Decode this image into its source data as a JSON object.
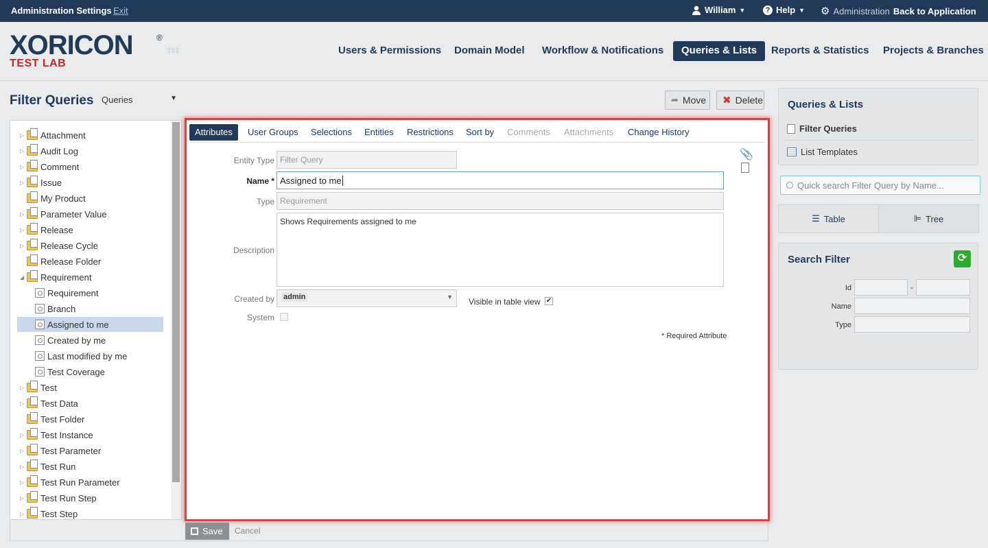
{
  "topbar": {
    "title": "Administration Settings",
    "exit": "Exit",
    "user": "William",
    "help": "Help",
    "admin": "Administration",
    "back": "Back to Application"
  },
  "logo": {
    "main": "XORICON",
    "sub": "TEST LAB"
  },
  "nav": [
    "Users & Permissions",
    "Domain Model",
    "Workflow & Notifications",
    "Queries & Lists",
    "Reports & Statistics",
    "Projects & Branches"
  ],
  "left": {
    "title": "Filter Queries",
    "select": "Queries",
    "tree": [
      {
        "label": "Attachment",
        "kind": "folder",
        "expand": "closed",
        "indent": 0
      },
      {
        "label": "Audit Log",
        "kind": "folder",
        "expand": "closed",
        "indent": 0
      },
      {
        "label": "Comment",
        "kind": "folder",
        "expand": "closed",
        "indent": 0
      },
      {
        "label": "Issue",
        "kind": "folder",
        "expand": "closed",
        "indent": 0
      },
      {
        "label": "My Product",
        "kind": "folder",
        "expand": "none",
        "indent": 0
      },
      {
        "label": "Parameter Value",
        "kind": "folder",
        "expand": "closed",
        "indent": 0
      },
      {
        "label": "Release",
        "kind": "folder",
        "expand": "closed",
        "indent": 0
      },
      {
        "label": "Release Cycle",
        "kind": "folder",
        "expand": "closed",
        "indent": 0
      },
      {
        "label": "Release Folder",
        "kind": "folder",
        "expand": "none",
        "indent": 0
      },
      {
        "label": "Requirement",
        "kind": "folder",
        "expand": "open",
        "indent": 0
      },
      {
        "label": "Requirement",
        "kind": "query",
        "expand": "none",
        "indent": 1
      },
      {
        "label": "Branch",
        "kind": "query",
        "expand": "none",
        "indent": 1
      },
      {
        "label": "Assigned to me",
        "kind": "query",
        "expand": "none",
        "indent": 1,
        "selected": true
      },
      {
        "label": "Created by me",
        "kind": "query",
        "expand": "none",
        "indent": 1
      },
      {
        "label": "Last modified by me",
        "kind": "query",
        "expand": "none",
        "indent": 1
      },
      {
        "label": "Test Coverage",
        "kind": "query",
        "expand": "none",
        "indent": 1
      },
      {
        "label": "Test",
        "kind": "folder",
        "expand": "closed",
        "indent": 0
      },
      {
        "label": "Test Data",
        "kind": "folder",
        "expand": "closed",
        "indent": 0
      },
      {
        "label": "Test Folder",
        "kind": "folder",
        "expand": "none",
        "indent": 0
      },
      {
        "label": "Test Instance",
        "kind": "folder",
        "expand": "closed",
        "indent": 0
      },
      {
        "label": "Test Parameter",
        "kind": "folder",
        "expand": "closed",
        "indent": 0
      },
      {
        "label": "Test Run",
        "kind": "folder",
        "expand": "closed",
        "indent": 0
      },
      {
        "label": "Test Run Parameter",
        "kind": "folder",
        "expand": "closed",
        "indent": 0
      },
      {
        "label": "Test Run Step",
        "kind": "folder",
        "expand": "closed",
        "indent": 0
      },
      {
        "label": "Test Step",
        "kind": "folder",
        "expand": "closed",
        "indent": 0
      }
    ]
  },
  "actions": {
    "move": "Move",
    "delete": "Delete"
  },
  "tabs": [
    {
      "label": "Attributes",
      "state": "active"
    },
    {
      "label": "User Groups",
      "state": "normal"
    },
    {
      "label": "Selections",
      "state": "normal"
    },
    {
      "label": "Entities",
      "state": "normal"
    },
    {
      "label": "Restrictions",
      "state": "normal"
    },
    {
      "label": "Sort by",
      "state": "normal"
    },
    {
      "label": "Comments",
      "state": "disabled"
    },
    {
      "label": "Attachments",
      "state": "disabled"
    },
    {
      "label": "Change History",
      "state": "normal"
    }
  ],
  "form": {
    "entity_type_label": "Entity Type",
    "entity_type": "Filter Query",
    "name_label": "Name *",
    "name": "Assigned to me",
    "type_label": "Type",
    "type": "Requirement",
    "description_label": "Description",
    "description": "Shows Requirements assigned to me",
    "created_by_label": "Created by",
    "created_by": "admin",
    "visible_label": "Visible in table view",
    "visible_checked": true,
    "system_label": "System",
    "system_checked": false,
    "required_note": "* Required Attribute"
  },
  "footer": {
    "save": "Save",
    "cancel": "Cancel"
  },
  "right": {
    "title": "Queries & Lists",
    "items": [
      "Filter Queries",
      "List Templates"
    ],
    "search_placeholder": "Quick search Filter Query by Name...",
    "view_table": "Table",
    "view_tree": "Tree",
    "filter_title": "Search Filter",
    "id_label": "Id",
    "name_label": "Name",
    "type_label": "Type",
    "range_sep": "-"
  },
  "colors": {
    "navy": "#213a5a",
    "accent_red": "#c0272d",
    "highlight": "#e53b3b",
    "green": "#2dab2a"
  }
}
